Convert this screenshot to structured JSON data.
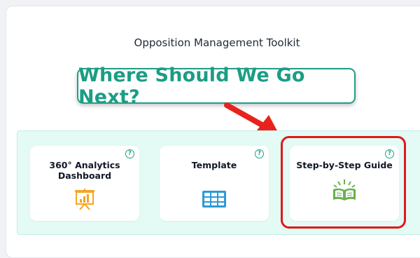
{
  "page": {
    "title": "Opposition Management Toolkit"
  },
  "callout": {
    "text": "Where Should We Go Next?"
  },
  "cards": [
    {
      "title": "360° Analytics Dashboard",
      "icon": "presentation-chart-icon",
      "help": "?"
    },
    {
      "title": "Template",
      "icon": "table-grid-icon",
      "help": "?"
    },
    {
      "title": "Step-by-Step Guide",
      "icon": "open-book-icon",
      "help": "?"
    }
  ],
  "colors": {
    "accent": "#1b9d85",
    "panel_background": "#e3faf5",
    "highlight": "#e0191a",
    "dashboard_icon": "#f5a623",
    "template_icon": "#2d9ad6",
    "guide_icon": "#6ab04c"
  }
}
